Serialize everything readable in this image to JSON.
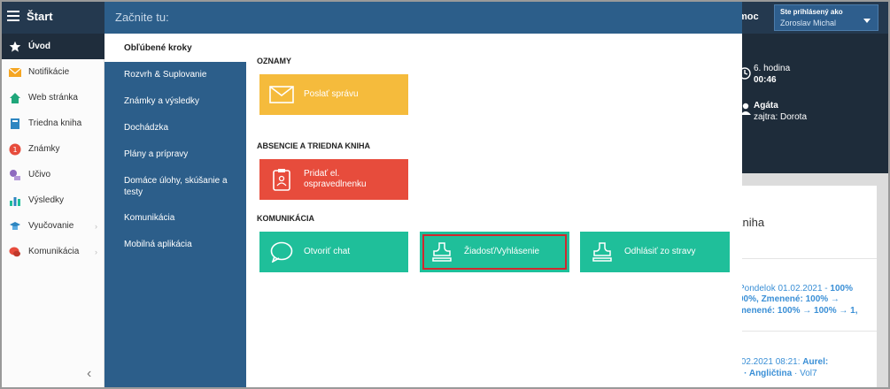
{
  "topbar": {
    "start_label": "Štart",
    "help_label": "moc",
    "user_label": "Ste prihlásený ako",
    "user_name": "Zoroslav Michal"
  },
  "sidebar": {
    "items": [
      {
        "label": "Úvod",
        "icon": "star-icon"
      },
      {
        "label": "Notifikácie",
        "icon": "envelope-icon"
      },
      {
        "label": "Web stránka",
        "icon": "home-icon"
      },
      {
        "label": "Triedna kniha",
        "icon": "book-icon"
      },
      {
        "label": "Známky",
        "icon": "grade-icon"
      },
      {
        "label": "Učivo",
        "icon": "curriculum-icon"
      },
      {
        "label": "Výsledky",
        "icon": "chart-icon"
      },
      {
        "label": "Vyučovanie",
        "icon": "teaching-icon"
      },
      {
        "label": "Komunikácia",
        "icon": "chat-icon"
      }
    ],
    "collapse_glyph": "‹"
  },
  "overlay": {
    "header": "Začnite tu:",
    "categories": [
      "Obľúbené kroky",
      "Rozvrh & Suplovanie",
      "Známky a výsledky",
      "Dochádzka",
      "Plány a prípravy",
      "Domáce úlohy, skúšanie a testy",
      "Komunikácia",
      "Mobilná aplikácia"
    ],
    "sections": {
      "announcements": "OZNAMY",
      "absence": "ABSENCIE A TRIEDNA KNIHA",
      "communication": "KOMUNIKÁCIA"
    },
    "tiles": {
      "send_message": "Poslať správu",
      "add_excuse_1": "Pridať el.",
      "add_excuse_2": "ospravedlnenku",
      "open_chat": "Otvoriť chat",
      "request": "Žiadosť/Vyhlásenie",
      "meal_cancel": "Odhlásiť zo stravy"
    }
  },
  "background": {
    "lesson": "6. hodina",
    "time": "00:46",
    "nameday": "Agáta",
    "nameday_tomorrow": "zajtra: Dorota",
    "card_title": "kniha",
    "entry1_line1_plain": "Pondelok 01.02.2021 - ",
    "entry1_line1_bold": "100%",
    "entry1_line2": "00%, Zmenené: 100% →",
    "entry1_line3": "menené: 100% → 100% → 1,",
    "entry2_line1_plain": ".02.2021 08:21: ",
    "entry2_line1_bold": "Aurel:",
    "entry2_line2_bold": "t · Angličtina",
    "entry2_line2_plain": " · Vol7"
  },
  "colors": {
    "topbar": "#24394f",
    "category_column": "#2c5e8a",
    "tile_yellow": "#f5bb3c",
    "tile_red": "#e74c3c",
    "tile_green": "#1fbf9a",
    "highlight": "#d0282e"
  }
}
